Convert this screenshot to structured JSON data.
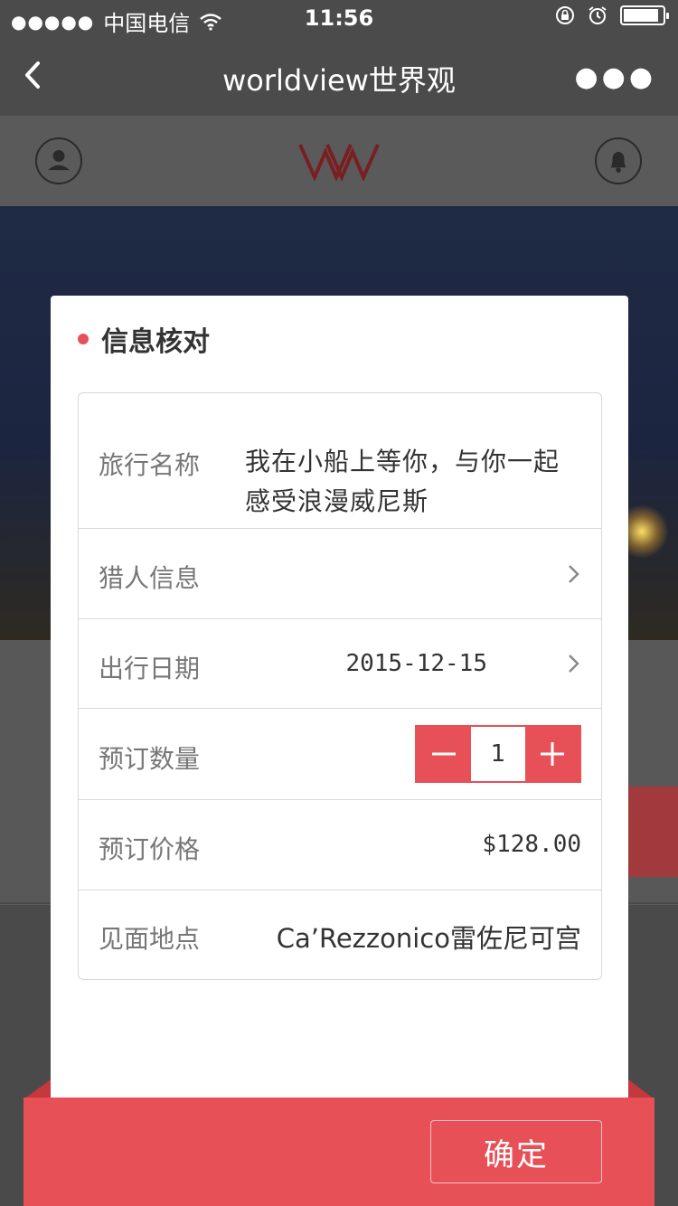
{
  "status_bar": {
    "signal": "●●●●●",
    "carrier": "中国电信",
    "time": "11:56"
  },
  "nav": {
    "title": "worldview世界观"
  },
  "modal": {
    "title": "信息核对",
    "rows": {
      "trip_name": {
        "label": "旅行名称",
        "value": "我在小船上等你，与你一起感受浪漫威尼斯"
      },
      "hunter_info": {
        "label": "猎人信息"
      },
      "travel_date": {
        "label": "出行日期",
        "value": "2015-12-15"
      },
      "quantity": {
        "label": "预订数量",
        "value": "1"
      },
      "price": {
        "label": "预订价格",
        "value": "$128.00"
      },
      "meeting_place": {
        "label": "见面地点",
        "value": "Ca’Rezzonico雷佐尼可宫"
      }
    }
  },
  "footer": {
    "confirm_label": "确定"
  },
  "colors": {
    "accent": "#e85057",
    "nav_bg": "#4b4b4b"
  },
  "icons": [
    "wifi-icon",
    "lock-rotation-icon",
    "alarm-icon",
    "battery-icon",
    "back-icon",
    "more-icon",
    "user-icon",
    "logo-icon",
    "bell-icon",
    "chevron-right-icon",
    "minus-icon",
    "plus-icon"
  ]
}
